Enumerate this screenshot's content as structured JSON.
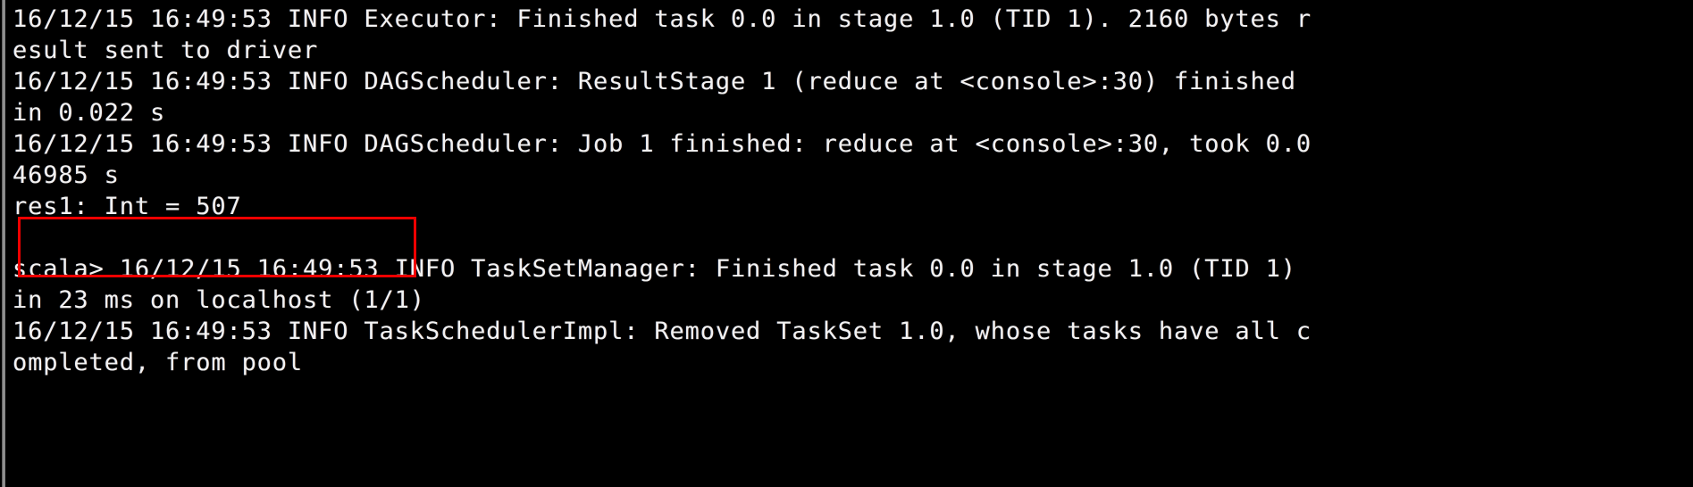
{
  "window": {
    "title": "Spark shell console",
    "background_color": "#000000",
    "text_color": "#f2f2f2",
    "gutter_color": "#8f8f8f"
  },
  "terminal": {
    "lines": [
      "16/12/15 16:49:53 INFO Executor: Finished task 0.0 in stage 1.0 (TID 1). 2160 bytes r",
      "esult sent to driver",
      "16/12/15 16:49:53 INFO DAGScheduler: ResultStage 1 (reduce at <console>:30) finished",
      "in 0.022 s",
      "16/12/15 16:49:53 INFO DAGScheduler: Job 1 finished: reduce at <console>:30, took 0.0",
      "46985 s",
      "res1: Int = 507",
      "",
      "scala> 16/12/15 16:49:53 INFO TaskSetManager: Finished task 0.0 in stage 1.0 (TID 1)",
      "in 23 ms on localhost (1/1)",
      "16/12/15 16:49:53 INFO TaskSchedulerImpl: Removed TaskSet 1.0, whose tasks have all c",
      "ompleted, from pool",
      ""
    ]
  },
  "annotation": {
    "label": "res1: Int = 507",
    "color": "#ee0000",
    "shape": "rectangle"
  }
}
